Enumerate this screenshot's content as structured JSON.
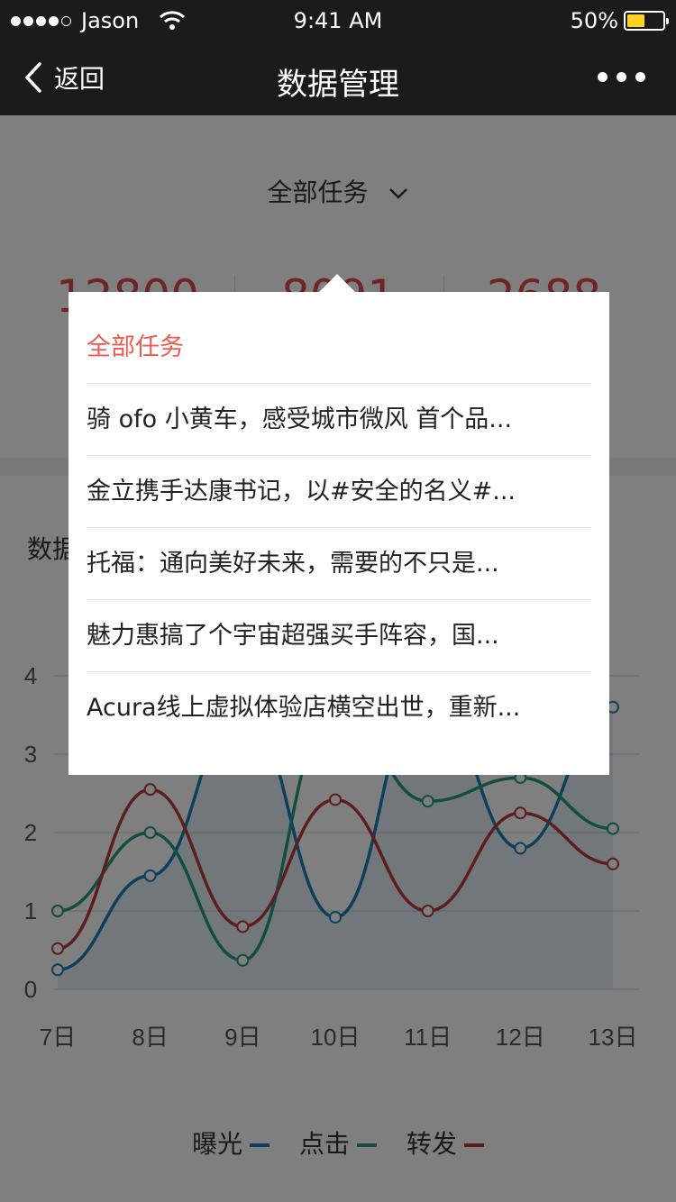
{
  "status_bar": {
    "carrier": "Jason",
    "time": "9:41 AM",
    "battery": "50%",
    "battery_level": 0.5
  },
  "nav": {
    "back_label": "返回",
    "title": "数据管理"
  },
  "filter": {
    "label": "全部任务"
  },
  "stats": [
    {
      "value": "12800"
    },
    {
      "value": "8091"
    },
    {
      "value": "2688"
    }
  ],
  "section": {
    "title": "数据趋势"
  },
  "menu": {
    "items": [
      {
        "label": "全部任务"
      },
      {
        "label": "骑 ofo 小黄车，感受城市微风 首个品..."
      },
      {
        "label": "金立携手达康书记，以#安全的名义#..."
      },
      {
        "label": "托福：通向美好未来，需要的不只是..."
      },
      {
        "label": "魅力惠搞了个宇宙超强买手阵容，国..."
      },
      {
        "label": "Acura线上虚拟体验店横空出世，重新..."
      }
    ]
  },
  "chart_data": {
    "type": "line",
    "categories": [
      "7日",
      "8日",
      "9日",
      "10日",
      "11日",
      "12日",
      "13日"
    ],
    "ylim": [
      0,
      4
    ],
    "yticks": [
      "0",
      "1",
      "2",
      "3",
      "4"
    ],
    "series": [
      {
        "name": "曝光",
        "color": "#1a7fb4",
        "values": [
          0.25,
          1.45,
          3.6,
          0.92,
          3.9,
          1.8,
          3.6
        ]
      },
      {
        "name": "点击",
        "color": "#279a85",
        "values": [
          1.0,
          2.0,
          0.37,
          3.6,
          2.4,
          2.7,
          2.05
        ]
      },
      {
        "name": "转发",
        "color": "#bb3a3a",
        "values": [
          0.52,
          2.55,
          0.8,
          2.42,
          1.0,
          2.25,
          1.6
        ]
      }
    ]
  }
}
